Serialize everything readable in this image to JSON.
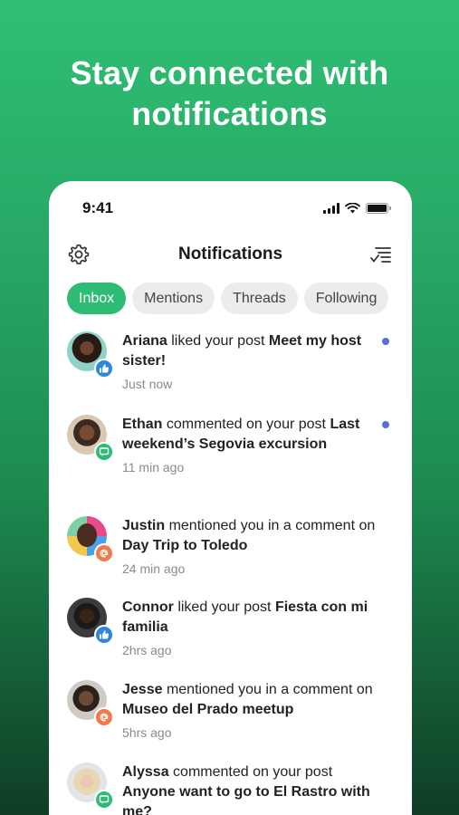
{
  "headline": [
    "Stay connected with",
    "notifications"
  ],
  "status": {
    "time": "9:41",
    "battery_level": 1.0
  },
  "nav": {
    "title": "Notifications",
    "left_icon": "gear-icon",
    "right_icon": "filter-checklist-icon"
  },
  "tabs": [
    "Inbox",
    "Mentions",
    "Threads",
    "Following"
  ],
  "active_tab": "Inbox",
  "colors": {
    "accent": "#2ebc74",
    "unread_dot": "#5b6dd8",
    "like_badge": "#2e86de",
    "comment_badge": "#2ebc74",
    "mention_badge": "#f07a4e"
  },
  "notifications": [
    {
      "name": "Ariana",
      "action": " liked your post ",
      "post": "Meet my host sister!",
      "time": "Just now",
      "type": "like",
      "unread": true
    },
    {
      "name": "Ethan",
      "action": " commented on your post ",
      "post": "Last weekend’s Segovia excursion",
      "time": "11 min ago",
      "type": "comment",
      "unread": true
    },
    {
      "name": "Justin",
      "action": " mentioned you in a comment on ",
      "post": "Day Trip to Toledo",
      "time": "24 min ago",
      "type": "mention",
      "unread": false
    },
    {
      "name": "Connor",
      "action": " liked your post ",
      "post": "Fiesta con mi familia",
      "time": "2hrs ago",
      "type": "like",
      "unread": false
    },
    {
      "name": "Jesse",
      "action": " mentioned you in a comment on ",
      "post": "Museo del Prado meetup",
      "time": "5hrs ago",
      "type": "mention",
      "unread": false
    },
    {
      "name": "Alyssa",
      "action": " commented on your post ",
      "post": "Anyone want to go to El Rastro with me?",
      "time": "",
      "type": "comment",
      "unread": false
    }
  ]
}
